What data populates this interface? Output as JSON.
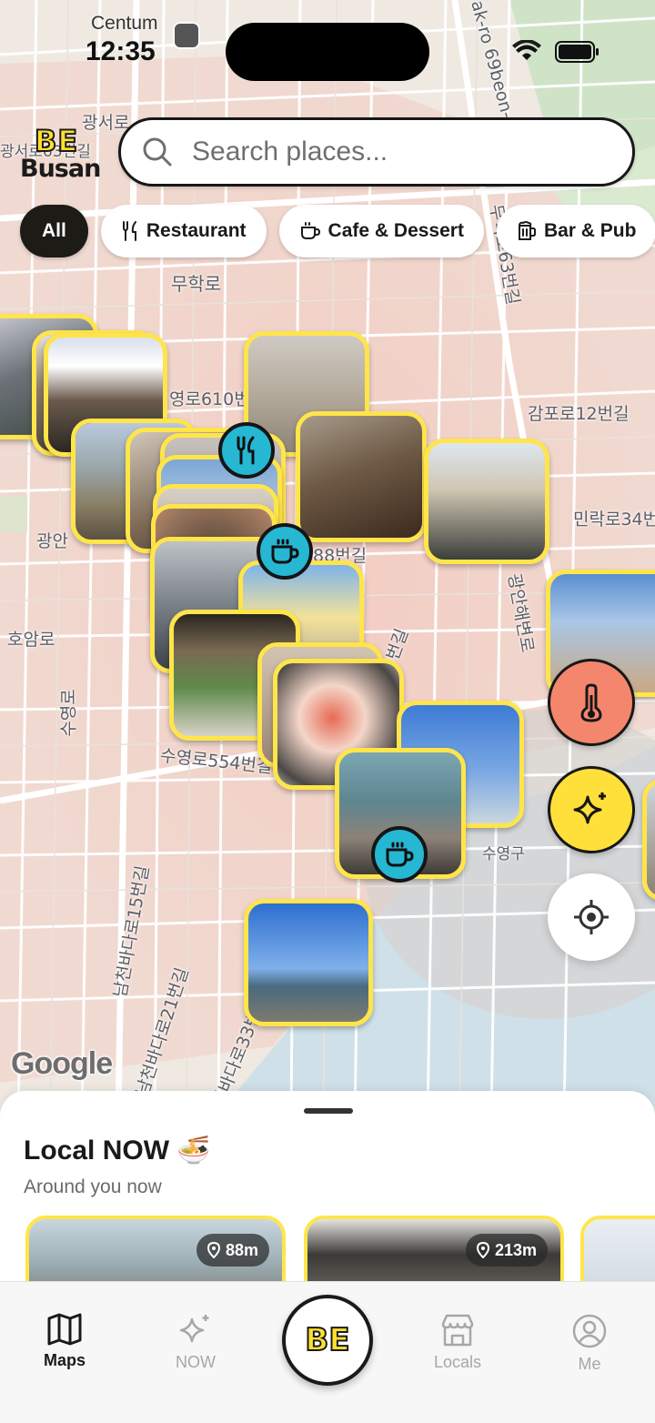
{
  "status_bar": {
    "time": "12:35",
    "location": "Centum",
    "icons": [
      "subway-icon",
      "cellular-icon",
      "wifi-icon",
      "battery-icon"
    ]
  },
  "brand": {
    "logo_top": "BE",
    "logo_bottom": "Busan",
    "accent": "#ffe54a"
  },
  "search": {
    "placeholder": "Search places...",
    "value": ""
  },
  "filters": [
    {
      "label": "All",
      "icon": "",
      "active": true
    },
    {
      "label": "Restaurant",
      "icon": "fork-knife-icon",
      "active": false
    },
    {
      "label": "Cafe & Dessert",
      "icon": "coffee-cup-icon",
      "active": false
    },
    {
      "label": "Bar & Pub",
      "icon": "beer-mug-icon",
      "active": false
    }
  ],
  "map": {
    "labels": [
      "광서로",
      "광서로63번길",
      "광안",
      "무학로",
      "영로610번",
      "감포로12번길",
      "민락로34번",
      "88번길",
      "호암로",
      "수영로",
      "수영로554번길",
      "수영구",
      "남천바다로15번길",
      "남천바다로21번길",
      "남천바다로33번길",
      "무학로63번길",
      "ak-ro 69beon-g",
      "광안해변로",
      "9번길"
    ],
    "attribution": "Google",
    "badges": [
      "fork-knife-icon",
      "coffee-cup-icon",
      "coffee-cup-icon"
    ]
  },
  "fab": {
    "thermometer": "thermometer-icon",
    "sparkle": "sparkle-icon",
    "locate": "locate-icon"
  },
  "sheet": {
    "title": "Local NOW 🍜",
    "subtitle": "Around you now",
    "cards": [
      {
        "distance": "88m"
      },
      {
        "distance": "213m"
      },
      {
        "distance": ""
      }
    ]
  },
  "tabs": [
    {
      "label": "Maps",
      "icon": "map-icon",
      "active": true
    },
    {
      "label": "NOW",
      "icon": "sparkle-icon",
      "active": false
    },
    {
      "label": "BE",
      "icon": "be-logo",
      "active": false
    },
    {
      "label": "Locals",
      "icon": "store-icon",
      "active": false
    },
    {
      "label": "Me",
      "icon": "user-icon",
      "active": false
    }
  ]
}
